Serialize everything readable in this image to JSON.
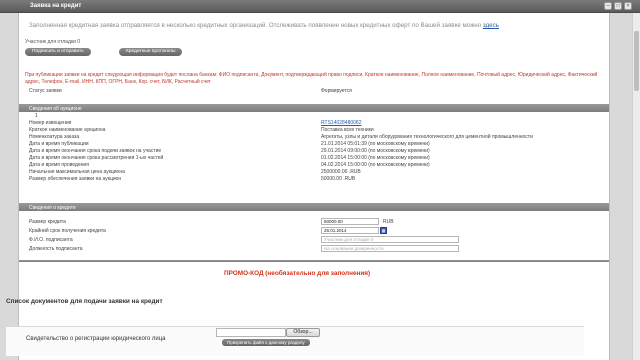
{
  "window": {
    "title": "Заявка на кредит",
    "controls": [
      "─",
      "□",
      "×"
    ]
  },
  "info": {
    "text": "Заполненная кредитная заявка отправляется в несколько кредитных организаций. Отслеживать появление новых кредитных оферт по Вашей заявке можно ",
    "link": "здесь"
  },
  "participant": "Участник для отладки 0",
  "buttons": {
    "sign_send": "Подписать и отправить",
    "credit_protocols": "Кредитные протоколы",
    "attach_file": "Прикрепить файл к данному разделу",
    "browse": "Обзор..."
  },
  "warning": "При публикации заявки на кредит следующая информация будет послана банкам: ФИО подписанта, Документ, подтверждающий право подписи, Краткое наименование, Полное наименование, Почтовый адрес, Юридический адрес, Фактический адрес, Телефон, E-mail, ИНН, КПП, ОГРН, Банк, Кор. счет, БИК, Расчетный счет",
  "status": {
    "label": "Статус заявки",
    "value": "Формируется"
  },
  "auction": {
    "header": "Сведения об аукционе",
    "marker": "1",
    "rows": [
      {
        "label": "Номер извещения",
        "value": "RTS14028480082"
      },
      {
        "label": "Краткое наименование аукциона",
        "value": "Поставка всех техники"
      },
      {
        "label": "Номенклатура заказа",
        "value": "Агрегаты, узлы и детали оборудования технологического для цементной промышленности"
      },
      {
        "label": "Дата и время публикации",
        "value": "21.01.2014 05:01:39 (по московскому времени)"
      },
      {
        "label": "Дата и время окончания срока подачи заявок на участие",
        "value": "29.01.2014 09:00:00 (по московскому времени)"
      },
      {
        "label": "Дата и время окончания срока рассмотрения 1-ых частей",
        "value": "01.02.2014 15:00:00 (по московскому времени)"
      },
      {
        "label": "Дата и время проведения",
        "value": "04.02.2014 15:00:00 (по московскому времени)"
      },
      {
        "label": "Начальная максимальная цена аукциона",
        "value": "2500000.00 .RUB"
      },
      {
        "label": "Размер обеспечения заявки на аукцион",
        "value": "50000.00 .RUB"
      }
    ]
  },
  "credit": {
    "header": "Сведения о кредите",
    "rows": [
      {
        "label": "Размер кредита",
        "value": "50000.00",
        "unit": "RUB"
      },
      {
        "label": "Крайний срок получения кредита",
        "value": "28.01.2014",
        "icon": "calendar-icon"
      },
      {
        "label": "Ф.И.О. подписанта",
        "placeholder": "Участник для отладки 0"
      },
      {
        "label": "Должность подписанта",
        "placeholder": "На основании доверенности"
      }
    ]
  },
  "promo": "ПРОМО-КОД (необязательно для заполнения)",
  "documents": {
    "title": "Список документов для подачи заявки на кредит",
    "items": [
      {
        "label": "Свидетельство о регистрации юридического лица"
      }
    ]
  },
  "colors": {
    "warning": "#c0392b",
    "promo": "#d0341a",
    "link": "#2a5db0",
    "section_bar": "#8a8a8a"
  }
}
